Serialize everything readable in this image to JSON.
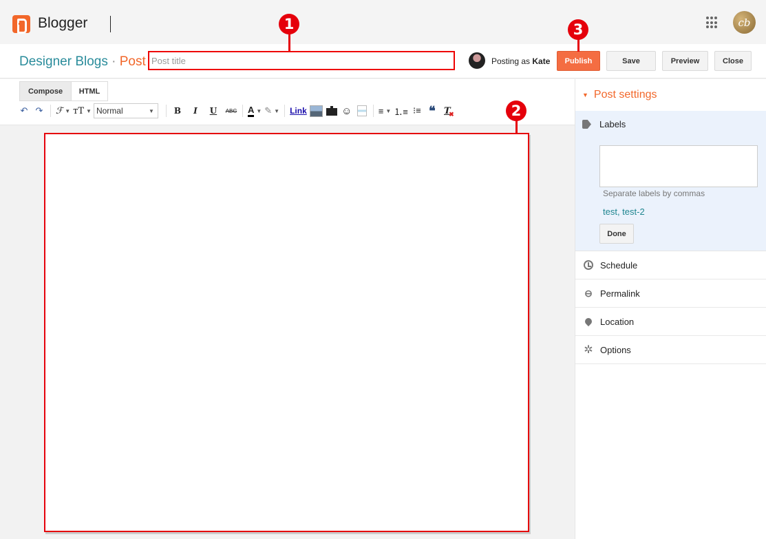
{
  "app": {
    "brand": "Blogger",
    "profile_initials": "cb"
  },
  "header": {
    "blog_name": "Designer Blogs",
    "separator": "·",
    "section": "Post",
    "title_placeholder": "Post title",
    "title_value": "",
    "posting_as_prefix": "Posting as",
    "posting_as_user": "Kate",
    "buttons": {
      "publish": "Publish",
      "save": "Save",
      "preview": "Preview",
      "close": "Close"
    }
  },
  "editor": {
    "mode_tabs": [
      {
        "label": "Compose",
        "active": true
      },
      {
        "label": "HTML",
        "active": false
      }
    ],
    "toolbar": {
      "font_size_value": "Normal",
      "bold": "B",
      "italic": "I",
      "underline": "U",
      "strike": "ABC",
      "link": "Link",
      "font_family_glyph": "ℱ",
      "font_size_glyph": "ᴛT",
      "text_color_glyph": "A",
      "clear_format_glyph": "T"
    },
    "body_content": ""
  },
  "annotations": [
    "1",
    "2",
    "3"
  ],
  "sidebar": {
    "header": "Post settings",
    "labels": {
      "title": "Labels",
      "textarea_value": "",
      "hint": "Separate labels by commas",
      "existing": "test, test-2",
      "done": "Done"
    },
    "items": [
      {
        "label": "Schedule",
        "icon": "clock-icon"
      },
      {
        "label": "Permalink",
        "icon": "link-icon"
      },
      {
        "label": "Location",
        "icon": "location-pin-icon"
      },
      {
        "label": "Options",
        "icon": "gear-icon"
      }
    ]
  },
  "colors": {
    "accent": "#f2672a",
    "teal": "#2a8c9b",
    "annotation": "#e5000b",
    "labels_bg": "#ebf2fc"
  }
}
